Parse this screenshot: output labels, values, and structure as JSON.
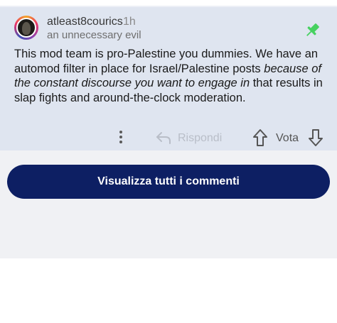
{
  "comment": {
    "username": "atleast8courics",
    "time": "1h",
    "flair": "an unnecessary evil",
    "body_part1": "This mod team is pro-Palestine you dummies. We have an automod filter in place for Israel/Palestine posts ",
    "body_italic": "because of the constant discourse you want to engage in",
    "body_part2": " that results in slap fights and around-the-clock moderation.",
    "pin_icon": "pin-icon",
    "pin_color": "#46d160"
  },
  "actions": {
    "more_icon": "more-vertical-icon",
    "reply_icon": "reply-arrow-icon",
    "reply_label": "Rispondi",
    "upvote_icon": "upvote-arrow-icon",
    "vote_label": "Vota",
    "downvote_icon": "downvote-arrow-icon"
  },
  "footer": {
    "view_all_label": "Visualizza tutti i commenti",
    "button_color": "#0d1f63"
  }
}
